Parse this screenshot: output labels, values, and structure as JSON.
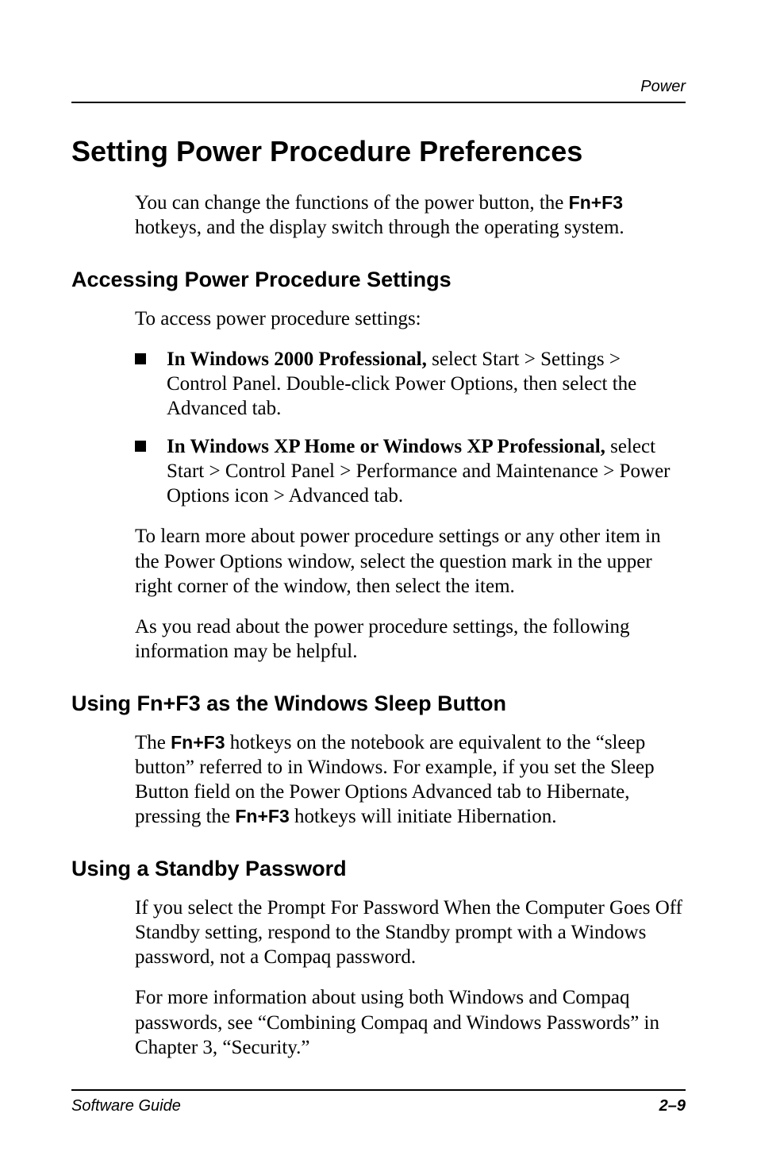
{
  "running_head": "Power",
  "h1": "Setting Power Procedure Preferences",
  "intro_pre": "You can change the functions of the power button, the ",
  "intro_hot": "Fn+F3",
  "intro_post": " hotkeys, and the display switch through the operating system.",
  "h2a": "Accessing Power Procedure Settings",
  "p_access": "To access power procedure settings:",
  "bullets": [
    {
      "lead": "In Windows 2000 Professional,",
      "rest": " select Start > Settings > Control Panel. Double-click Power Options, then select the Advanced tab."
    },
    {
      "lead": "In Windows XP Home or Windows XP Professional,",
      "rest": " select Start > Control Panel > Performance and Maintenance > Power Options icon > Advanced tab."
    }
  ],
  "p_learn": "To learn more about power procedure settings or any other item in the Power Options window, select the question mark in the upper right corner of the window, then select the item.",
  "p_asread": "As you read about the power procedure settings, the following information may be helpful.",
  "h2b": "Using Fn+F3 as the Windows Sleep Button",
  "sleep_pre": "The ",
  "sleep_hot1": "Fn+F3",
  "sleep_mid": " hotkeys on the notebook are equivalent to the “sleep button” referred to in Windows. For example, if you set the Sleep Button field on the Power Options Advanced tab to Hibernate, pressing the ",
  "sleep_hot2": "Fn+F3",
  "sleep_post": " hotkeys will initiate Hibernation.",
  "h2c": "Using a Standby Password",
  "p_standby1": "If you select the Prompt For Password When the Computer Goes Off Standby setting, respond to the Standby prompt with a Windows password, not a Compaq password.",
  "p_standby2": "For more information about using both Windows and Compaq passwords, see “Combining Compaq and Windows Passwords” in Chapter 3, “Security.”",
  "footer_left": "Software Guide",
  "footer_right": "2–9"
}
